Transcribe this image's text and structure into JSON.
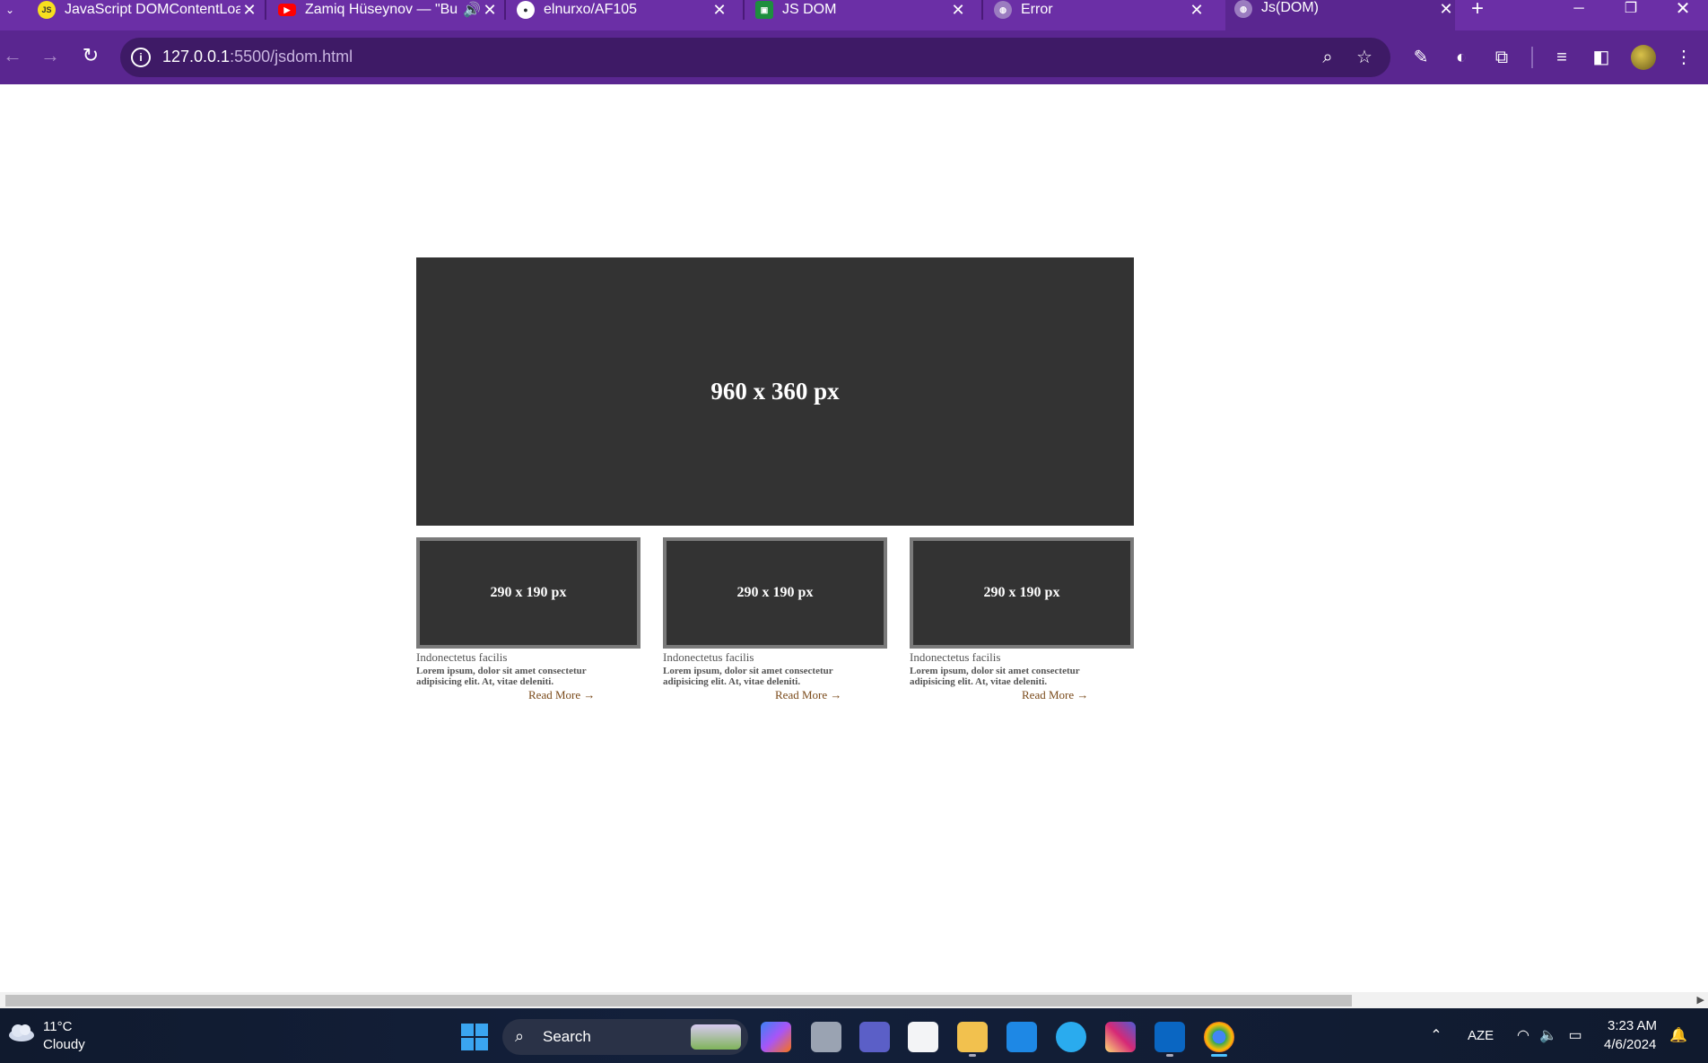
{
  "browser": {
    "tabs": [
      {
        "title": "JavaScript DOMContentLoaded",
        "favicon": "js-icon",
        "audio": false
      },
      {
        "title": "Zamiq Hüseynov — \"Bu",
        "favicon": "youtube-icon",
        "audio": true
      },
      {
        "title": "elnurxo/AF105",
        "favicon": "github-icon",
        "audio": false
      },
      {
        "title": "JS DOM",
        "favicon": "classroom-icon",
        "audio": false
      },
      {
        "title": "Error",
        "favicon": "globe-icon",
        "audio": false
      },
      {
        "title": "Js(DOM)",
        "favicon": "globe-icon",
        "audio": false,
        "active": true
      }
    ],
    "url_host": "127.0.0.1",
    "url_path": ":5500/jsdom.html",
    "accent": "#6b2fa6"
  },
  "page": {
    "hero_label": "960 x 360 px",
    "cards": [
      {
        "image_label": "290 x 190 px",
        "title": "Indonectetus facilis",
        "desc": "Lorem ipsum, dolor sit amet consectetur adipisicing elit. At, vitae deleniti.",
        "link": "Read More →"
      },
      {
        "image_label": "290 x 190 px",
        "title": "Indonectetus facilis",
        "desc": "Lorem ipsum, dolor sit amet consectetur adipisicing elit. At, vitae deleniti.",
        "link": "Read More →"
      },
      {
        "image_label": "290 x 190 px",
        "title": "Indonectetus facilis",
        "desc": "Lorem ipsum, dolor sit amet consectetur adipisicing elit. At, vitae deleniti.",
        "link": "Read More →"
      }
    ]
  },
  "taskbar": {
    "weather_temp": "11°C",
    "weather_condition": "Cloudy",
    "search_label": "Search",
    "language": "AZE",
    "time": "3:23 AM",
    "date": "4/6/2024"
  }
}
